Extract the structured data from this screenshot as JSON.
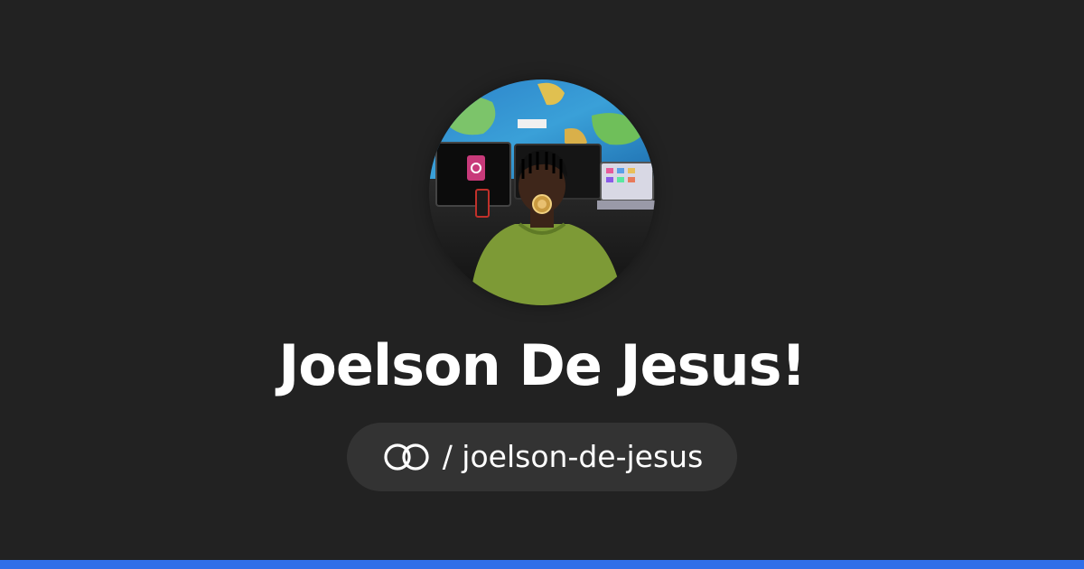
{
  "profile": {
    "name": "Joelson De Jesus!",
    "handle": "/ joelson-de-jesus",
    "avatar_alt": "Profile photo"
  },
  "icons": {
    "logo": "interlocking-rings-icon"
  },
  "colors": {
    "background": "#222222",
    "pill": "#333333",
    "text": "#ffffff",
    "accent_bar": "#2f6fe8"
  }
}
